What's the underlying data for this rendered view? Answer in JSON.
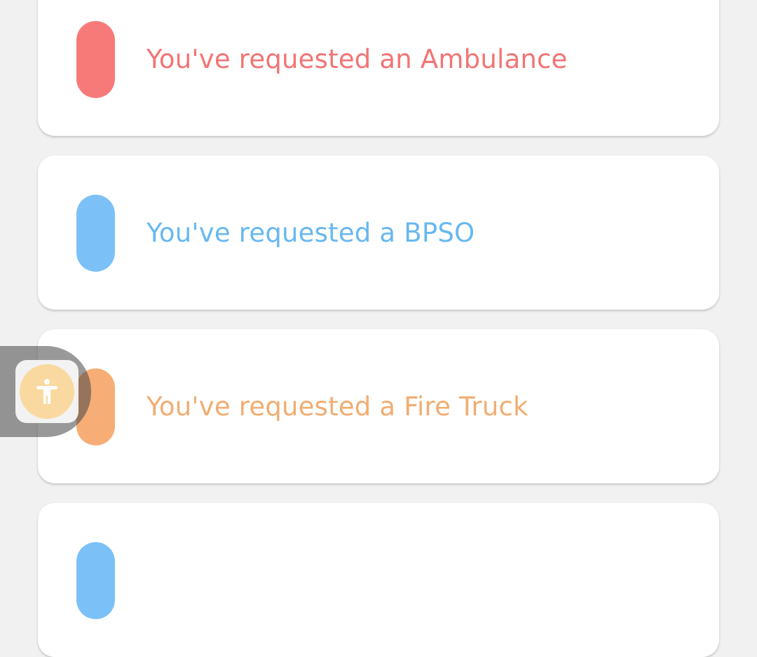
{
  "requests": [
    {
      "label": "You've requested an Ambulance",
      "color": "#f27474",
      "pill_color": "#f77a78"
    },
    {
      "label": "You've requested a BPSO",
      "color": "#68b8f0",
      "pill_color": "#7bc1f8"
    },
    {
      "label": "You've requested a Fire Truck",
      "color": "#f0ad72",
      "pill_color": "#f6ae76"
    },
    {
      "label": "",
      "color": "#68b8f0",
      "pill_color": "#7bc1f8"
    }
  ],
  "accessibility_button": {
    "icon": "accessibility-icon",
    "color": "#fad9a0"
  }
}
